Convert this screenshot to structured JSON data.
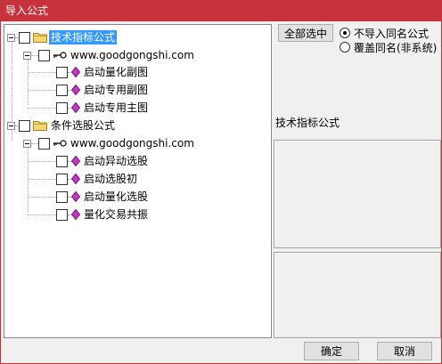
{
  "window": {
    "title": "导入公式"
  },
  "tree": {
    "groups": [
      {
        "label": "技术指标公式",
        "selected": true,
        "site": "www.goodgongshi.com",
        "items": [
          "启动量化副图",
          "启动专用副图",
          "启动专用主图"
        ]
      },
      {
        "label": "条件选股公式",
        "selected": false,
        "site": "www.goodgongshi.com",
        "items": [
          "启动异动选股",
          "启动选股初",
          "启动量化选股",
          "量化交易共振"
        ]
      }
    ]
  },
  "side": {
    "select_all_label": "全部选中",
    "options": [
      {
        "label": "不导入同名公式",
        "checked": true
      },
      {
        "label": "覆盖同名(非系统)",
        "checked": false
      }
    ],
    "info_label": "技术指标公式"
  },
  "buttons": {
    "ok": "确定",
    "cancel": "取消"
  },
  "colors": {
    "titlebar": "#c8323c",
    "selection": "#3399ff",
    "gem": "#cc33cc",
    "folder": "#f5d76e"
  }
}
